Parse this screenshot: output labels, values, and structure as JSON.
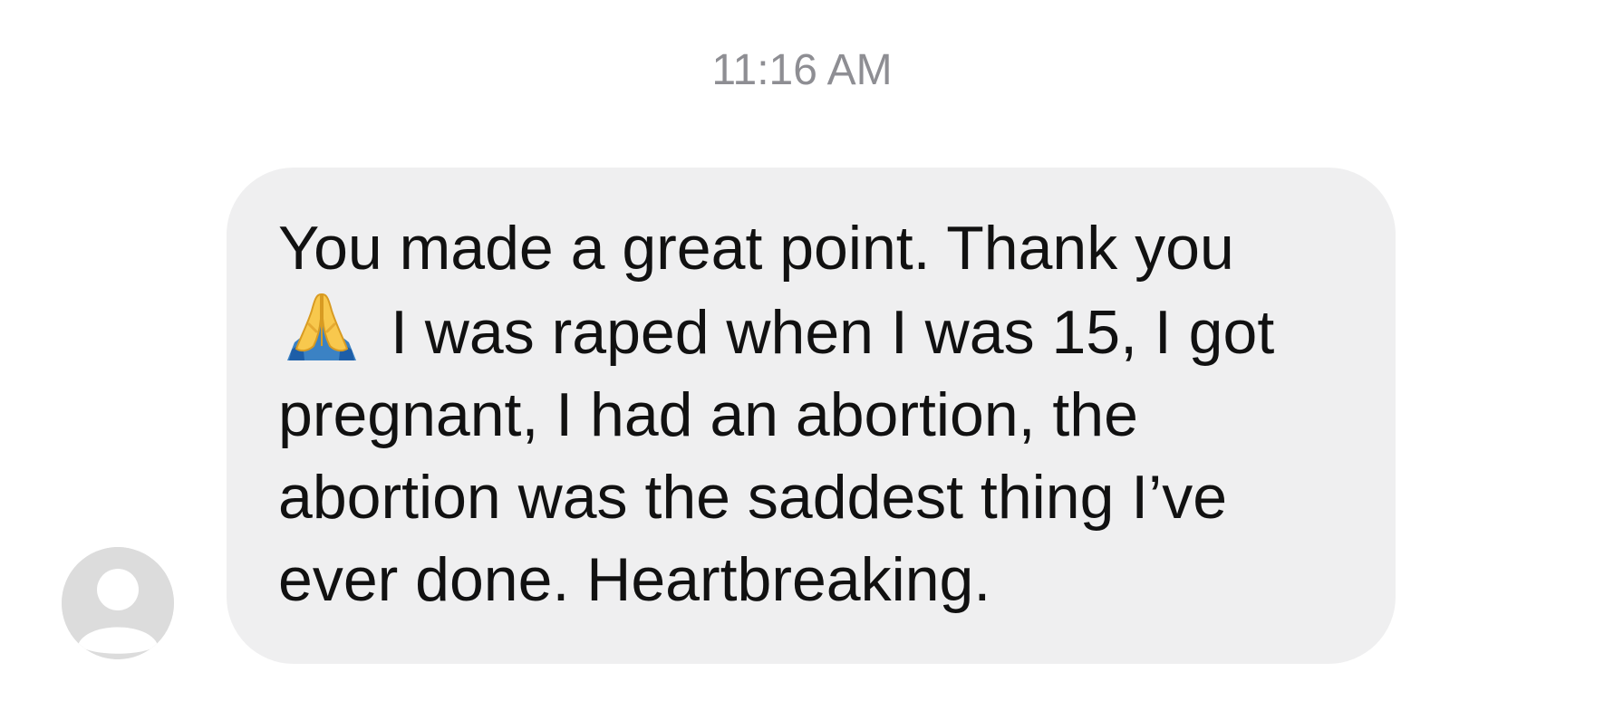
{
  "conversation": {
    "timestamp": "11:16 AM",
    "message": {
      "line1": "You made a great point. Thank you",
      "emoji": "folded-hands-icon",
      "line2_after_emoji": "I was raped when I was 15, I got",
      "line3": "pregnant, I had an abortion, the",
      "line4": "abortion was the saddest thing I’ve",
      "line5": "ever done. Heartbreaking."
    },
    "sender_avatar": "default-person-avatar-icon"
  },
  "colors": {
    "bubble_background": "#efeff0",
    "timestamp_text": "#8e8e93",
    "avatar_background": "#dcdcdc"
  }
}
